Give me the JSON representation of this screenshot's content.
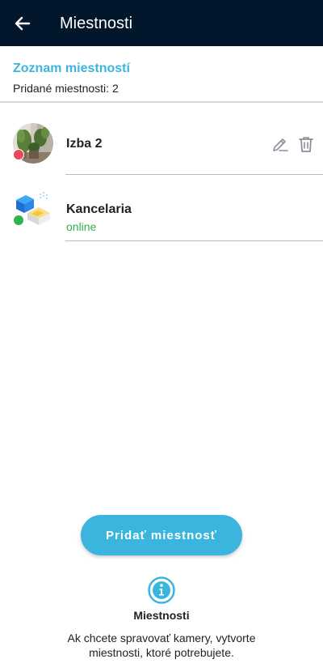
{
  "header": {
    "title": "Miestnosti",
    "background": "#03172c"
  },
  "section": {
    "title": "Zoznam miestností",
    "count_text": "Pridané miestnosti: 2",
    "accent": "#3cb5de"
  },
  "rooms": [
    {
      "name": "Izba 2",
      "status": "",
      "status_color": "#e84a5a",
      "avatar_icon": "plants-room-photo",
      "actions": [
        "edit-icon",
        "trash-icon"
      ]
    },
    {
      "name": "Kancelaria",
      "status": "online",
      "status_color": "#2fb34a",
      "avatar_icon": "office-isometric-icon"
    }
  ],
  "add_button": {
    "label": "Pridať miestnosť"
  },
  "info": {
    "icon": "info-icon",
    "title": "Miestnosti",
    "text": "Ak chcete spravovať kamery, vytvorte miestnosti, ktoré potrebujete."
  }
}
